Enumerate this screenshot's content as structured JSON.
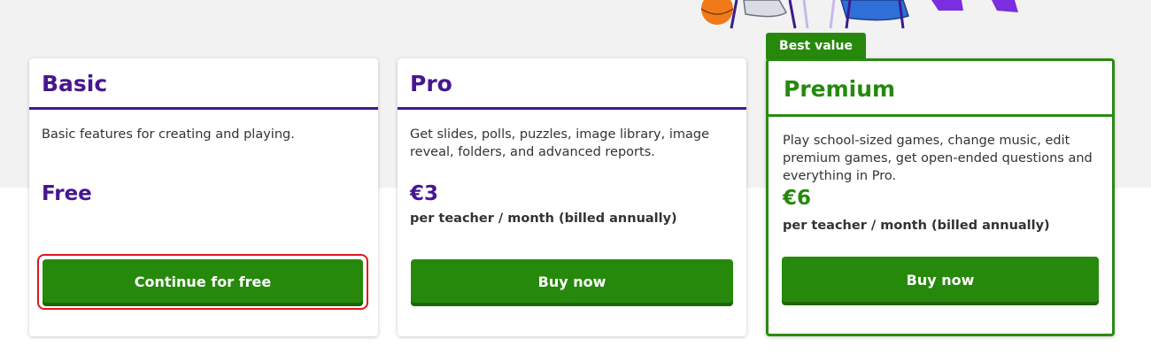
{
  "plans": [
    {
      "name": "Basic",
      "description": "Basic features for creating and playing.",
      "price": "Free",
      "period": "",
      "button": "Continue for free"
    },
    {
      "name": "Pro",
      "description": "Get slides, polls, puzzles, image library, image reveal, folders, and advanced reports.",
      "price": "€3",
      "period": "per teacher / month (billed annually)",
      "button": "Buy now"
    },
    {
      "name": "Premium",
      "badge": "Best value",
      "description": "Play school-sized games, change music, edit premium games, get open-ended questions and everything in Pro.",
      "price": "€6",
      "period": "per teacher / month (billed annually)",
      "button": "Buy now"
    }
  ],
  "colors": {
    "purple": "#46178f",
    "green": "#26890c",
    "highlight_red": "#e0151f",
    "background_gray": "#f2f2f2"
  },
  "icons": [
    "basketball-icon",
    "sneaker-icon",
    "chair-icon",
    "high-heel-icon"
  ]
}
